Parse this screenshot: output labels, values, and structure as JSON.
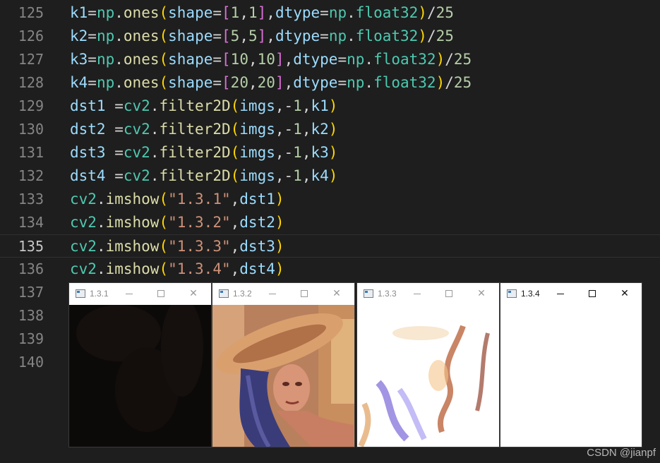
{
  "editor": {
    "lines": [
      {
        "num": "125",
        "tokens": [
          [
            "v",
            "k1"
          ],
          [
            "o",
            "="
          ],
          [
            "m",
            "np"
          ],
          [
            "o",
            "."
          ],
          [
            "f",
            "ones"
          ],
          [
            "p1",
            "("
          ],
          [
            "v",
            "shape"
          ],
          [
            "o",
            "="
          ],
          [
            "p2",
            "["
          ],
          [
            "n",
            "1"
          ],
          [
            "o",
            ","
          ],
          [
            "n",
            "1"
          ],
          [
            "p2",
            "]"
          ],
          [
            "o",
            ","
          ],
          [
            "v",
            "dtype"
          ],
          [
            "o",
            "="
          ],
          [
            "m",
            "np"
          ],
          [
            "o",
            "."
          ],
          [
            "m",
            "float32"
          ],
          [
            "p1",
            ")"
          ],
          [
            "o",
            "/"
          ],
          [
            "n",
            "25"
          ]
        ]
      },
      {
        "num": "126",
        "tokens": [
          [
            "v",
            "k2"
          ],
          [
            "o",
            "="
          ],
          [
            "m",
            "np"
          ],
          [
            "o",
            "."
          ],
          [
            "f",
            "ones"
          ],
          [
            "p1",
            "("
          ],
          [
            "v",
            "shape"
          ],
          [
            "o",
            "="
          ],
          [
            "p2",
            "["
          ],
          [
            "n",
            "5"
          ],
          [
            "o",
            ","
          ],
          [
            "n",
            "5"
          ],
          [
            "p2",
            "]"
          ],
          [
            "o",
            ","
          ],
          [
            "v",
            "dtype"
          ],
          [
            "o",
            "="
          ],
          [
            "m",
            "np"
          ],
          [
            "o",
            "."
          ],
          [
            "m",
            "float32"
          ],
          [
            "p1",
            ")"
          ],
          [
            "o",
            "/"
          ],
          [
            "n",
            "25"
          ]
        ]
      },
      {
        "num": "127",
        "tokens": [
          [
            "v",
            "k3"
          ],
          [
            "o",
            "="
          ],
          [
            "m",
            "np"
          ],
          [
            "o",
            "."
          ],
          [
            "f",
            "ones"
          ],
          [
            "p1",
            "("
          ],
          [
            "v",
            "shape"
          ],
          [
            "o",
            "="
          ],
          [
            "p2",
            "["
          ],
          [
            "n",
            "10"
          ],
          [
            "o",
            ","
          ],
          [
            "n",
            "10"
          ],
          [
            "p2",
            "]"
          ],
          [
            "o",
            ","
          ],
          [
            "v",
            "dtype"
          ],
          [
            "o",
            "="
          ],
          [
            "m",
            "np"
          ],
          [
            "o",
            "."
          ],
          [
            "m",
            "float32"
          ],
          [
            "p1",
            ")"
          ],
          [
            "o",
            "/"
          ],
          [
            "n",
            "25"
          ]
        ]
      },
      {
        "num": "128",
        "tokens": [
          [
            "v",
            "k4"
          ],
          [
            "o",
            "="
          ],
          [
            "m",
            "np"
          ],
          [
            "o",
            "."
          ],
          [
            "f",
            "ones"
          ],
          [
            "p1",
            "("
          ],
          [
            "v",
            "shape"
          ],
          [
            "o",
            "="
          ],
          [
            "p2",
            "["
          ],
          [
            "n",
            "20"
          ],
          [
            "o",
            ","
          ],
          [
            "n",
            "20"
          ],
          [
            "p2",
            "]"
          ],
          [
            "o",
            ","
          ],
          [
            "v",
            "dtype"
          ],
          [
            "o",
            "="
          ],
          [
            "m",
            "np"
          ],
          [
            "o",
            "."
          ],
          [
            "m",
            "float32"
          ],
          [
            "p1",
            ")"
          ],
          [
            "o",
            "/"
          ],
          [
            "n",
            "25"
          ]
        ]
      },
      {
        "num": "129",
        "tokens": [
          [
            "v",
            "dst1"
          ],
          [
            "o",
            " ="
          ],
          [
            "m",
            "cv2"
          ],
          [
            "o",
            "."
          ],
          [
            "f",
            "filter2D"
          ],
          [
            "p1",
            "("
          ],
          [
            "v",
            "imgs"
          ],
          [
            "o",
            ",-"
          ],
          [
            "n",
            "1"
          ],
          [
            "o",
            ","
          ],
          [
            "v",
            "k1"
          ],
          [
            "p1",
            ")"
          ]
        ]
      },
      {
        "num": "130",
        "tokens": [
          [
            "v",
            "dst2"
          ],
          [
            "o",
            " ="
          ],
          [
            "m",
            "cv2"
          ],
          [
            "o",
            "."
          ],
          [
            "f",
            "filter2D"
          ],
          [
            "p1",
            "("
          ],
          [
            "v",
            "imgs"
          ],
          [
            "o",
            ",-"
          ],
          [
            "n",
            "1"
          ],
          [
            "o",
            ","
          ],
          [
            "v",
            "k2"
          ],
          [
            "p1",
            ")"
          ]
        ]
      },
      {
        "num": "131",
        "tokens": [
          [
            "v",
            "dst3"
          ],
          [
            "o",
            " ="
          ],
          [
            "m",
            "cv2"
          ],
          [
            "o",
            "."
          ],
          [
            "f",
            "filter2D"
          ],
          [
            "p1",
            "("
          ],
          [
            "v",
            "imgs"
          ],
          [
            "o",
            ",-"
          ],
          [
            "n",
            "1"
          ],
          [
            "o",
            ","
          ],
          [
            "v",
            "k3"
          ],
          [
            "p1",
            ")"
          ]
        ]
      },
      {
        "num": "132",
        "tokens": [
          [
            "v",
            "dst4"
          ],
          [
            "o",
            " ="
          ],
          [
            "m",
            "cv2"
          ],
          [
            "o",
            "."
          ],
          [
            "f",
            "filter2D"
          ],
          [
            "p1",
            "("
          ],
          [
            "v",
            "imgs"
          ],
          [
            "o",
            ",-"
          ],
          [
            "n",
            "1"
          ],
          [
            "o",
            ","
          ],
          [
            "v",
            "k4"
          ],
          [
            "p1",
            ")"
          ]
        ]
      },
      {
        "num": "133",
        "tokens": [
          [
            "m",
            "cv2"
          ],
          [
            "o",
            "."
          ],
          [
            "f",
            "imshow"
          ],
          [
            "p1",
            "("
          ],
          [
            "s",
            "\"1.3.1\""
          ],
          [
            "o",
            ","
          ],
          [
            "v",
            "dst1"
          ],
          [
            "p1",
            ")"
          ]
        ]
      },
      {
        "num": "134",
        "tokens": [
          [
            "m",
            "cv2"
          ],
          [
            "o",
            "."
          ],
          [
            "f",
            "imshow"
          ],
          [
            "p1",
            "("
          ],
          [
            "s",
            "\"1.3.2\""
          ],
          [
            "o",
            ","
          ],
          [
            "v",
            "dst2"
          ],
          [
            "p1",
            ")"
          ]
        ]
      },
      {
        "num": "135",
        "current": true,
        "tokens": [
          [
            "m",
            "cv2"
          ],
          [
            "o",
            "."
          ],
          [
            "f",
            "imshow"
          ],
          [
            "p1",
            "("
          ],
          [
            "s",
            "\"1.3.3\""
          ],
          [
            "o",
            ","
          ],
          [
            "v",
            "dst3"
          ],
          [
            "p1",
            ")"
          ]
        ]
      },
      {
        "num": "136",
        "tokens": [
          [
            "m",
            "cv2"
          ],
          [
            "o",
            "."
          ],
          [
            "f",
            "imshow"
          ],
          [
            "p1",
            "("
          ],
          [
            "s",
            "\"1.3.4\""
          ],
          [
            "o",
            ","
          ],
          [
            "v",
            "dst4"
          ],
          [
            "p1",
            ")"
          ]
        ]
      },
      {
        "num": "137",
        "tokens": []
      },
      {
        "num": "138",
        "tokens": []
      },
      {
        "num": "139",
        "tokens": []
      },
      {
        "num": "140",
        "tokens": []
      }
    ]
  },
  "windows": [
    {
      "title": "1.3.1",
      "content": "near-black blurred image",
      "active": false
    },
    {
      "title": "1.3.2",
      "content": "portrait photo (woman with hat)",
      "active": false
    },
    {
      "title": "1.3.3",
      "content": "overexposed blurred image",
      "active": false
    },
    {
      "title": "1.3.4",
      "content": "white image",
      "active": true
    }
  ],
  "window_buttons": {
    "minimize": "minimize-icon",
    "maximize": "maximize-icon",
    "close": "close-icon"
  },
  "watermark": "CSDN @jianpf",
  "colors": {
    "background": "#1e1e1e",
    "variable": "#9cdcfe",
    "module": "#4ec9b0",
    "function": "#dcdcaa",
    "number": "#b5cea8",
    "string": "#ce9178",
    "bracket1": "#ffd700",
    "bracket2": "#da70d6"
  }
}
